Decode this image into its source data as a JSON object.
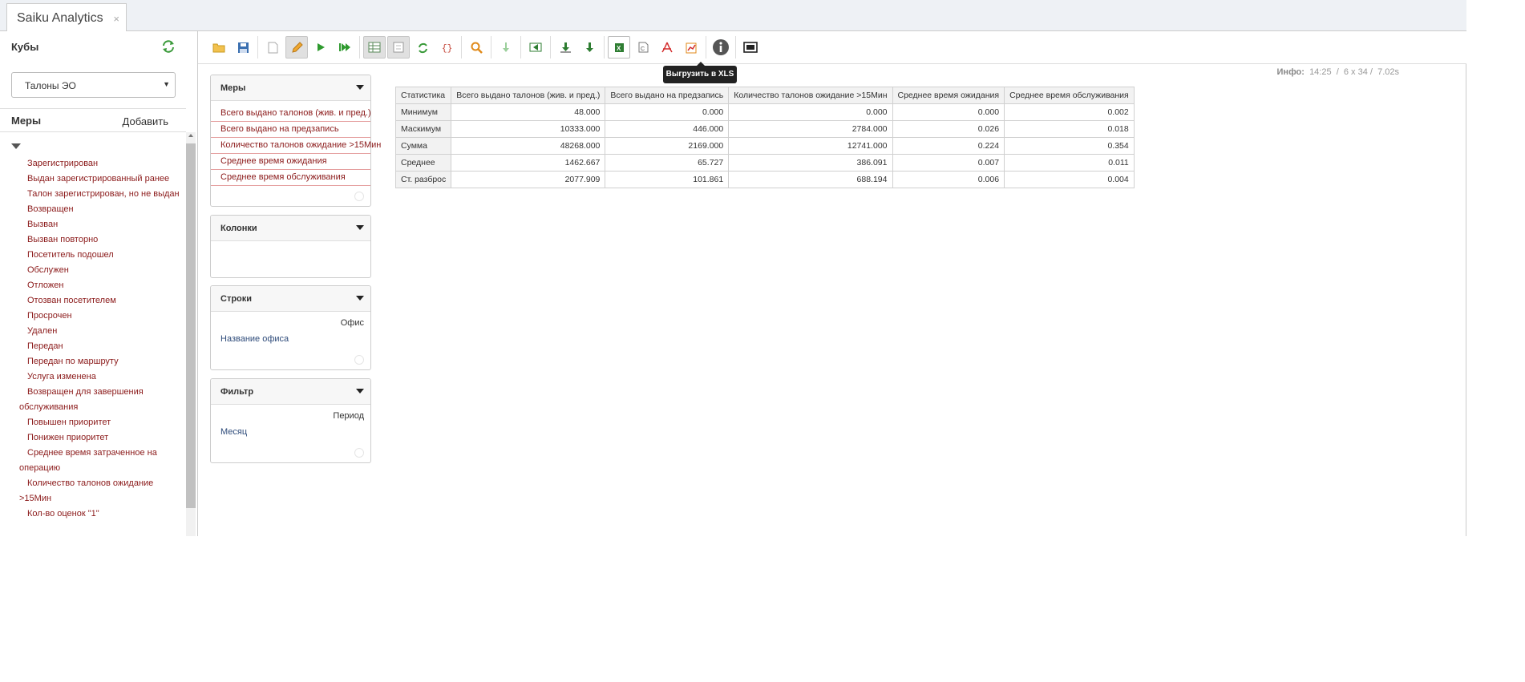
{
  "tab": {
    "title": "Saiku Analytics",
    "close": "×"
  },
  "sidebar": {
    "cubes_header": "Кубы",
    "cube_selected": "Талоны ЭО",
    "measures_header": "Меры",
    "add_label": "Добавить",
    "tree_items": [
      "Зарегистрирован",
      "Выдан зарегистрированный ранее",
      "Талон зарегистрирован, но не выдан",
      "Возвращен",
      "Вызван",
      "Вызван повторно",
      "Посетитель подошел",
      "Обслужен",
      "Отложен",
      "Отозван посетителем",
      "Просрочен",
      "Удален",
      "Передан",
      "Передан по маршруту",
      "Услуга изменена",
      "Возвращен для завершения обслуживания",
      "Повышен приоритет",
      "Понижен приоритет",
      "Среднее время затраченное на операцию",
      "Количество талонов ожидание >15Мин",
      "Кол-во оценок \"1\""
    ]
  },
  "toolbar": {
    "tooltip": "Выгрузить в XLS",
    "buttons": [
      "open-icon",
      "save-icon",
      "new-icon",
      "edit-icon",
      "run-icon",
      "auto-run-icon",
      "hide-parents-icon",
      "non-empty-icon",
      "swap-axis-icon",
      "mdx-icon",
      "zoom-icon",
      "drill-down-icon",
      "drill-across-icon",
      "export-icon",
      "export-all-icon",
      "export-xls-icon",
      "export-csv-icon",
      "export-pdf-icon",
      "export-image-icon",
      "info-icon",
      "presentation-icon"
    ]
  },
  "info": {
    "label": "Инфо:",
    "time": "14:25",
    "size": "6 x 34",
    "duration": "7.02s"
  },
  "panels": {
    "measures": {
      "title": "Меры",
      "items": [
        "Всего выдано талонов (жив. и пред.)",
        "Всего выдано на предзапись",
        "Количество талонов ожидание >15Мин",
        "Среднее время ожидания",
        "Среднее время обслуживания"
      ]
    },
    "columns": {
      "title": "Колонки"
    },
    "rows": {
      "title": "Строки",
      "dimension": "Офис",
      "level": "Название офиса"
    },
    "filter": {
      "title": "Фильтр",
      "dimension": "Период",
      "level": "Месяц"
    }
  },
  "grid": {
    "headers": [
      "Статистика",
      "Всего выдано талонов (жив. и пред.)",
      "Всего выдано на предзапись",
      "Количество талонов ожидание >15Мин",
      "Среднее время ожидания",
      "Среднее время обслуживания"
    ],
    "rows": [
      {
        "label": "Минимум",
        "values": [
          "48.000",
          "0.000",
          "0.000",
          "0.000",
          "0.002"
        ]
      },
      {
        "label": "Маскимум",
        "values": [
          "10333.000",
          "446.000",
          "2784.000",
          "0.026",
          "0.018"
        ]
      },
      {
        "label": "Сумма",
        "values": [
          "48268.000",
          "2169.000",
          "12741.000",
          "0.224",
          "0.354"
        ]
      },
      {
        "label": "Среднее",
        "values": [
          "1462.667",
          "65.727",
          "386.091",
          "0.007",
          "0.011"
        ]
      },
      {
        "label": "Ст. разброс",
        "values": [
          "2077.909",
          "101.861",
          "688.194",
          "0.006",
          "0.004"
        ]
      }
    ]
  }
}
